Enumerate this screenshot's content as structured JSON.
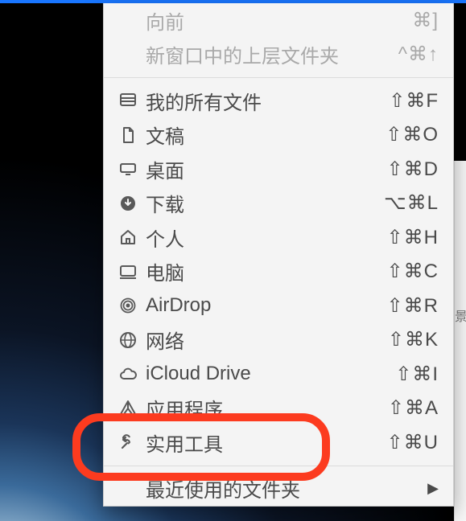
{
  "top_disabled": [
    {
      "label": "向前",
      "shortcut": "⌘]"
    },
    {
      "label": "新窗口中的上层文件夹",
      "shortcut": "^⌘↑"
    }
  ],
  "go_items": [
    {
      "icon": "all-files-icon",
      "label": "我的所有文件",
      "shortcut": "⇧⌘F"
    },
    {
      "icon": "documents-icon",
      "label": "文稿",
      "shortcut": "⇧⌘O"
    },
    {
      "icon": "desktop-icon",
      "label": "桌面",
      "shortcut": "⇧⌘D"
    },
    {
      "icon": "downloads-icon",
      "label": "下载",
      "shortcut": "⌥⌘L"
    },
    {
      "icon": "home-icon",
      "label": "个人",
      "shortcut": "⇧⌘H"
    },
    {
      "icon": "computer-icon",
      "label": "电脑",
      "shortcut": "⇧⌘C"
    },
    {
      "icon": "airdrop-icon",
      "label": "AirDrop",
      "shortcut": "⇧⌘R"
    },
    {
      "icon": "network-icon",
      "label": "网络",
      "shortcut": "⇧⌘K"
    },
    {
      "icon": "icloud-icon",
      "label": "iCloud Drive",
      "shortcut": "⇧⌘I"
    },
    {
      "icon": "applications-icon",
      "label": "应用程序",
      "shortcut": "⇧⌘A"
    },
    {
      "icon": "utilities-icon",
      "label": "实用工具",
      "shortcut": "⇧⌘U"
    }
  ],
  "recent": {
    "label": "最近使用的文件夹"
  },
  "highlight": {
    "color": "#fc3b1f",
    "target_index": 10
  },
  "behind_char": "景"
}
